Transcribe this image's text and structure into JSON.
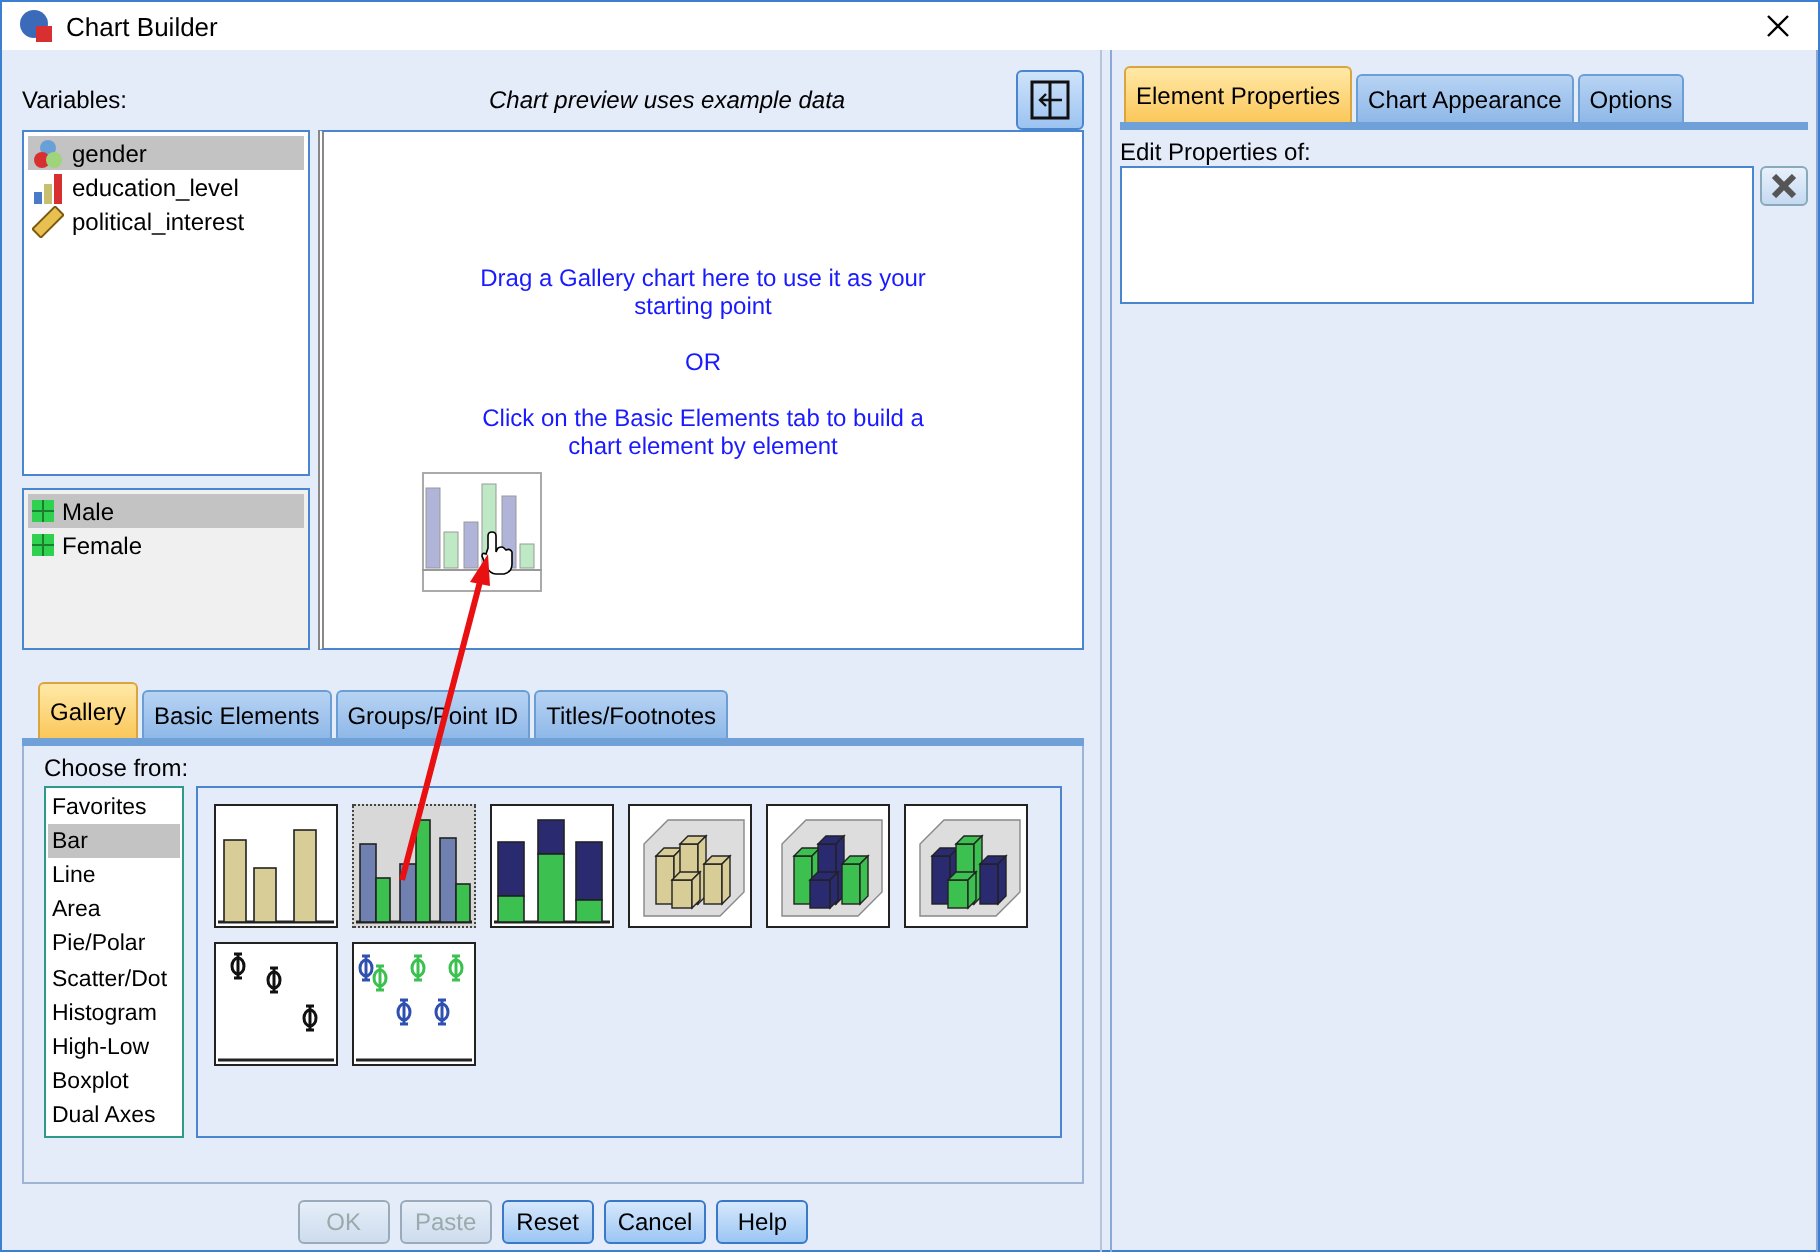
{
  "window": {
    "title": "Chart Builder"
  },
  "variables": {
    "label": "Variables:",
    "items": [
      {
        "name": "gender",
        "kind": "nominal",
        "selected": true
      },
      {
        "name": "education_level",
        "kind": "ordinal",
        "selected": false
      },
      {
        "name": "political_interest",
        "kind": "scale",
        "selected": false
      }
    ]
  },
  "categories": [
    {
      "name": "Male",
      "selected": true
    },
    {
      "name": "Female",
      "selected": false
    }
  ],
  "preview": {
    "caption": "Chart preview uses example data",
    "messages": [
      "Drag a Gallery chart here to use it as your starting point",
      "OR",
      "Click on the Basic Elements tab to build a chart element by element"
    ]
  },
  "bottom_tabs": [
    {
      "label": "Gallery",
      "selected": true
    },
    {
      "label": "Basic Elements",
      "selected": false
    },
    {
      "label": "Groups/Point ID",
      "selected": false
    },
    {
      "label": "Titles/Footnotes",
      "selected": false
    }
  ],
  "gallery": {
    "label": "Choose from:",
    "types": [
      {
        "label": "Favorites",
        "selected": false
      },
      {
        "label": "Bar",
        "selected": true
      },
      {
        "label": "Line",
        "selected": false
      },
      {
        "label": "Area",
        "selected": false
      },
      {
        "label": "Pie/Polar",
        "selected": false
      },
      {
        "label": "Scatter/Dot",
        "selected": false
      },
      {
        "label": "Histogram",
        "selected": false
      },
      {
        "label": "High-Low",
        "selected": false
      },
      {
        "label": "Boxplot",
        "selected": false
      },
      {
        "label": "Dual Axes",
        "selected": false
      }
    ],
    "charts": [
      {
        "kind": "simple",
        "selected": false
      },
      {
        "kind": "clustered",
        "selected": true
      },
      {
        "kind": "stacked",
        "selected": false
      },
      {
        "kind": "simple3d",
        "selected": false
      },
      {
        "kind": "clustered3d",
        "selected": false
      },
      {
        "kind": "stacked3d",
        "selected": false
      },
      {
        "kind": "error",
        "selected": false
      },
      {
        "kind": "clustered-error",
        "selected": false
      }
    ]
  },
  "buttons": [
    {
      "label": "OK",
      "disabled": true
    },
    {
      "label": "Paste",
      "disabled": true
    },
    {
      "label": "Reset",
      "disabled": false
    },
    {
      "label": "Cancel",
      "disabled": false
    },
    {
      "label": "Help",
      "disabled": false
    }
  ],
  "right_tabs": [
    {
      "label": "Element Properties",
      "selected": true
    },
    {
      "label": "Chart Appearance",
      "selected": false
    },
    {
      "label": "Options",
      "selected": false
    }
  ],
  "properties": {
    "label": "Edit Properties of:"
  }
}
